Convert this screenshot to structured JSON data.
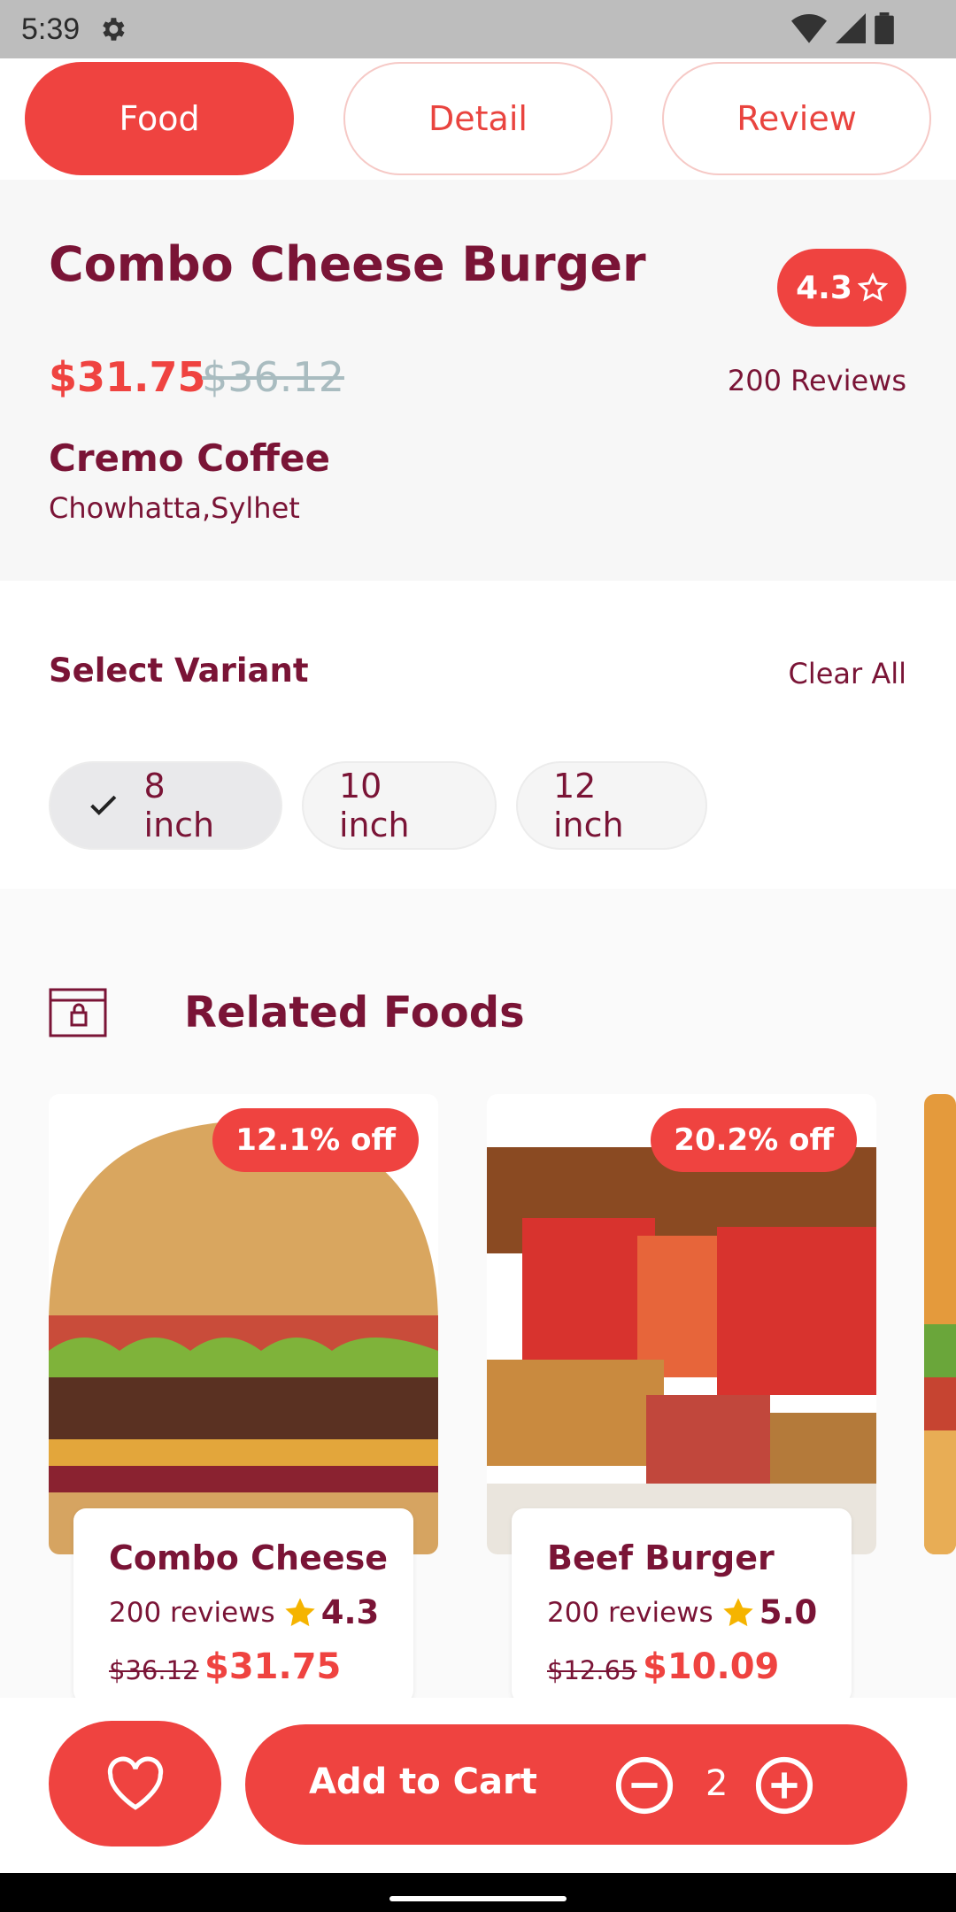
{
  "status_bar": {
    "time": "5:39"
  },
  "tabs": [
    {
      "label": "Food",
      "active": true
    },
    {
      "label": "Detail",
      "active": false
    },
    {
      "label": "Review",
      "active": false
    }
  ],
  "product": {
    "title": "Combo Cheese Burger",
    "rating": "4.3",
    "price": "$31.75",
    "old_price": "$36.12",
    "reviews": "200 Reviews",
    "store_name": "Cremo Coffee",
    "store_location": "Chowhatta,Sylhet"
  },
  "variants": {
    "title": "Select Variant",
    "clear_label": "Clear All",
    "options": [
      {
        "label": "8 inch",
        "selected": true
      },
      {
        "label": "10 inch",
        "selected": false
      },
      {
        "label": "12 inch",
        "selected": false
      }
    ]
  },
  "related": {
    "title": "Related Foods",
    "items": [
      {
        "name": "Combo Cheese Burger",
        "reviews": "200 reviews",
        "rating": "4.3",
        "old_price": "$36.12",
        "price": "$31.75",
        "discount": "12.1% off"
      },
      {
        "name": "Beef Burger",
        "reviews": "200 reviews",
        "rating": "5.0",
        "old_price": "$12.65",
        "price": "$10.09",
        "discount": "20.2% off"
      }
    ]
  },
  "bottom_bar": {
    "add_to_cart": "Add to Cart",
    "quantity": "2"
  },
  "colors": {
    "accent": "#ef4340",
    "text": "#7a1436",
    "muted_price": "#a9bcc0",
    "star": "#f5b400"
  }
}
